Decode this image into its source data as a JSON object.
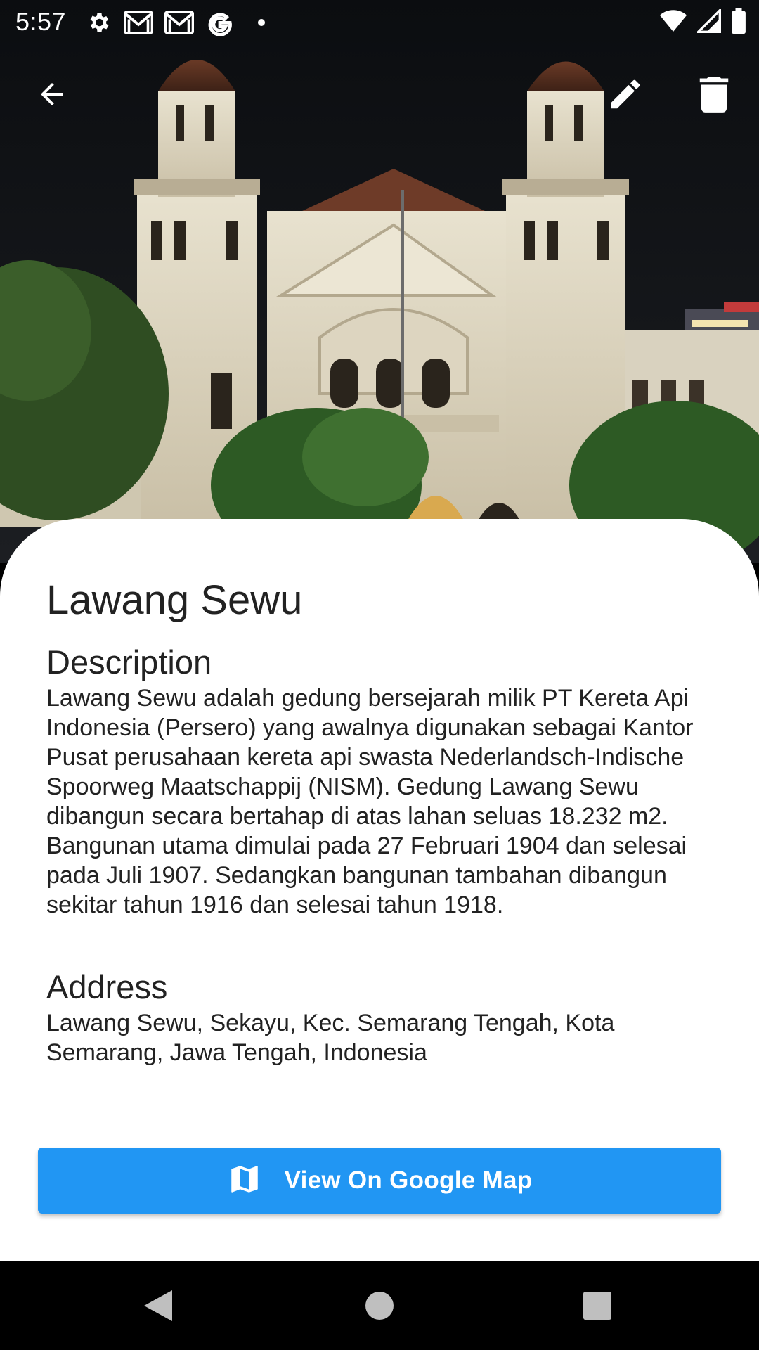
{
  "status_bar": {
    "time": "5:57",
    "notification_icons": [
      "settings-icon",
      "gmail-icon",
      "gmail-icon",
      "google-icon",
      "dot-icon"
    ],
    "system_icons": [
      "wifi-icon",
      "cell-signal-icon",
      "battery-icon"
    ]
  },
  "app_bar": {
    "back_icon": "arrow-back-icon",
    "actions": [
      "edit-icon",
      "delete-icon"
    ]
  },
  "place": {
    "name": "Lawang Sewu",
    "description_heading": "Description",
    "description": "Lawang Sewu adalah gedung bersejarah milik PT Kereta Api Indonesia (Persero) yang awalnya digunakan sebagai Kantor Pusat perusahaan kereta api swasta Nederlandsch-Indische Spoorweg Maatschappij (NISM). Gedung Lawang Sewu dibangun secara bertahap di atas lahan seluas 18.232 m2. Bangunan utama dimulai pada 27 Februari 1904 dan selesai pada Juli 1907. Sedangkan bangunan tambahan dibangun sekitar tahun 1916 dan selesai tahun 1918.",
    "address_heading": "Address",
    "address": "Lawang Sewu, Sekayu, Kec. Semarang Tengah, Kota Semarang, Jawa Tengah, Indonesia"
  },
  "map_button": {
    "icon": "map-icon",
    "label": "View On Google Map"
  },
  "colors": {
    "accent": "#2196F3",
    "card": "#FFFFFF",
    "text": "#222222"
  },
  "nav_bar": [
    "back-triangle-icon",
    "home-circle-icon",
    "recents-square-icon"
  ]
}
